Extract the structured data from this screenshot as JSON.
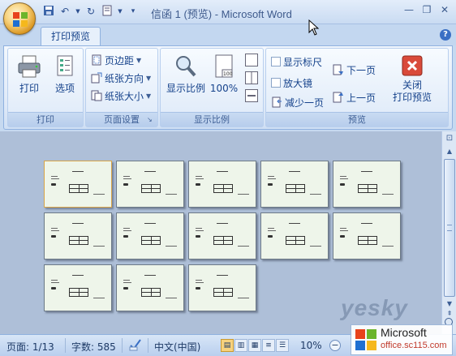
{
  "window": {
    "title": "信函 1 (预览) - Microsoft Word"
  },
  "tabs": {
    "active": "打印预览"
  },
  "ribbon": {
    "print_group": {
      "label": "打印",
      "print": "打印",
      "options": "选项"
    },
    "page_setup_group": {
      "label": "页面设置",
      "margins": "页边距",
      "orientation": "纸张方向",
      "size": "纸张大小"
    },
    "zoom_group": {
      "label": "显示比例",
      "zoom": "显示比例",
      "hundred": "100%"
    },
    "preview_group": {
      "label": "预览",
      "show_ruler": "显示标尺",
      "magnifier": "放大镜",
      "shrink_one_page": "减少一页",
      "next_page": "下一页",
      "prev_page": "上一页",
      "close_preview_line1": "关闭",
      "close_preview_line2": "打印预览"
    }
  },
  "status": {
    "page": "页面: 1/13",
    "words": "字数: 585",
    "language": "中文(中国)",
    "zoom": "10%"
  },
  "document": {
    "page_count": 13,
    "selected_page": 1
  },
  "watermark": {
    "yesky": "yesky",
    "microsoft": "Microsoft",
    "site": "office.sc115.com"
  }
}
